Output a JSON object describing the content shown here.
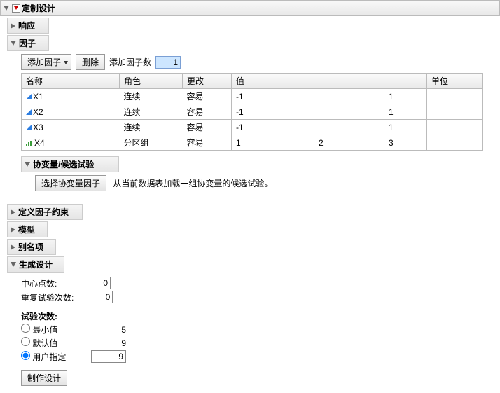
{
  "main": {
    "title": "定制设计"
  },
  "sections": {
    "response": {
      "title": "响应"
    },
    "factor": {
      "title": "因子",
      "toolbar": {
        "add": "添加因子",
        "remove": "删除",
        "addCountLabel": "添加因子数",
        "addCountValue": "1"
      },
      "cols": {
        "name": "名称",
        "role": "角色",
        "change": "更改",
        "value": "值",
        "unit": "单位"
      },
      "rows": [
        {
          "name": "X1",
          "role": "连续",
          "change": "容易",
          "type": "cont",
          "v1": "-1",
          "v2": "1"
        },
        {
          "name": "X2",
          "role": "连续",
          "change": "容易",
          "type": "cont",
          "v1": "-1",
          "v2": "1"
        },
        {
          "name": "X3",
          "role": "连续",
          "change": "容易",
          "type": "cont",
          "v1": "-1",
          "v2": "1"
        },
        {
          "name": "X4",
          "role": "分区组",
          "change": "容易",
          "type": "cat",
          "v1": "1",
          "v2": "2",
          "v3": "3"
        }
      ]
    },
    "covariate": {
      "title": "协变量/候选试验",
      "btn": "选择协变量因子",
      "help": "从当前数据表加载一组协变量的候选试验。"
    },
    "constraint": {
      "title": "定义因子约束"
    },
    "model": {
      "title": "模型"
    },
    "alias": {
      "title": "别名项"
    },
    "generate": {
      "title": "生成设计",
      "centerLabel": "中心点数:",
      "centerValue": "0",
      "repLabel": "重复试验次数:",
      "repValue": "0",
      "runsLabel": "试验次数:",
      "radios": {
        "min": {
          "label": "最小值",
          "val": "5"
        },
        "def": {
          "label": "默认值",
          "val": "9"
        },
        "user": {
          "label": "用户指定",
          "val": "9"
        }
      },
      "makeBtn": "制作设计"
    }
  }
}
